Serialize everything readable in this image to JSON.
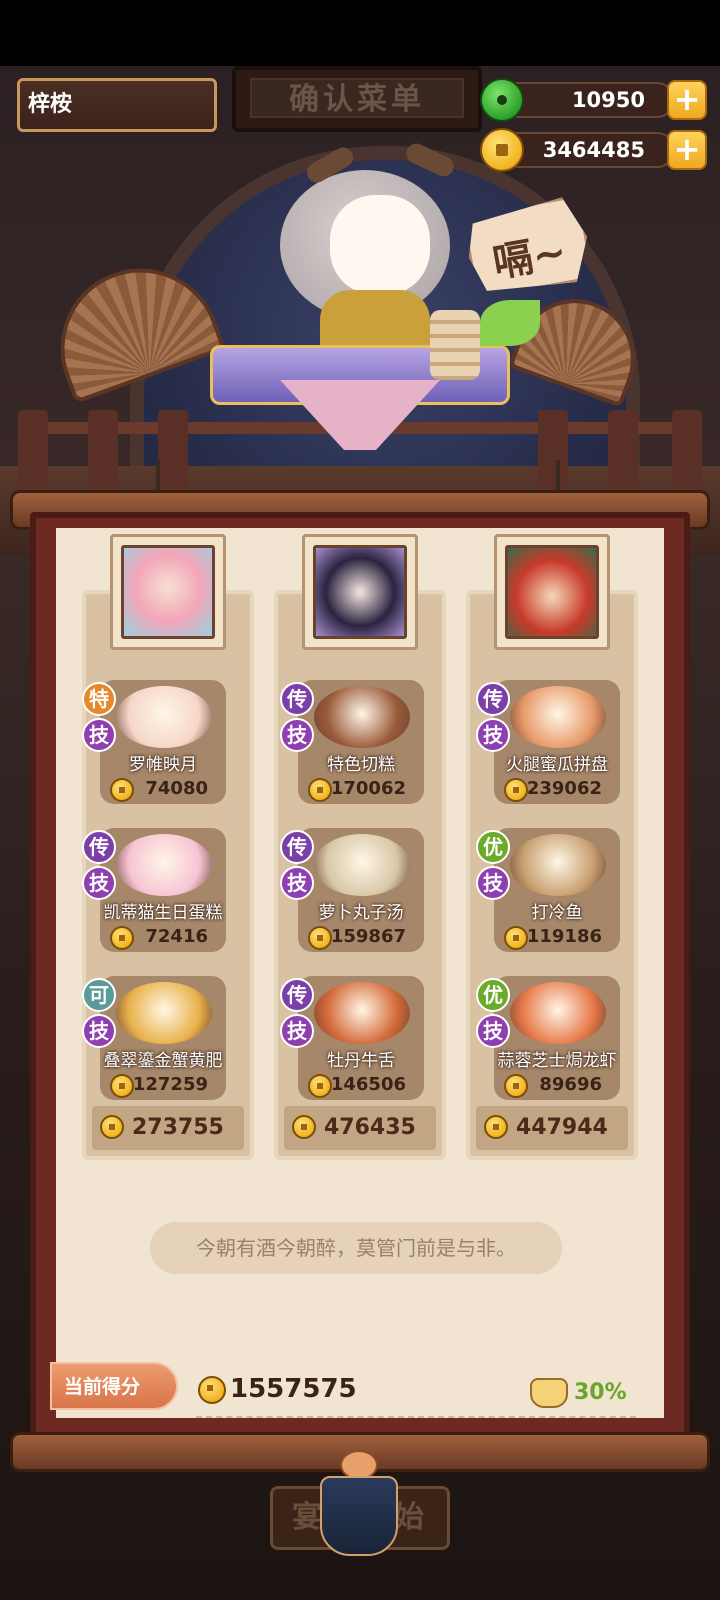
{
  "header": {
    "player_name": "梓桉",
    "sign_title": "确认菜单",
    "jade_amount": "10950",
    "coin_amount": "3464485",
    "plus_label": "+"
  },
  "character": {
    "speech": "嗝~"
  },
  "columns": [
    {
      "total": "273755",
      "dishes": [
        {
          "tag1": "特",
          "tag1_color": "#e7882a",
          "tag2": "技",
          "name": "罗帷映月",
          "price": "74080",
          "food_color": "#f5d6c8"
        },
        {
          "tag1": "传",
          "tag1_color": "#7b3fa8",
          "tag2": "技",
          "name": "凯蒂猫生日蛋糕",
          "price": "72416",
          "food_color": "#f7c4d4"
        },
        {
          "tag1": "可",
          "tag1_color": "#5a9a9a",
          "tag2": "技",
          "name": "叠翠鎏金蟹黄肥",
          "price": "127259",
          "food_color": "#e8b24a"
        }
      ]
    },
    {
      "total": "476435",
      "dishes": [
        {
          "tag1": "传",
          "tag1_color": "#7b3fa8",
          "tag2": "技",
          "name": "特色切糕",
          "price": "170062",
          "food_color": "#9a5a3a"
        },
        {
          "tag1": "传",
          "tag1_color": "#7b3fa8",
          "tag2": "技",
          "name": "萝卜丸子汤",
          "price": "159867",
          "food_color": "#d8c8a8"
        },
        {
          "tag1": "传",
          "tag1_color": "#7b3fa8",
          "tag2": "技",
          "name": "牡丹牛舌",
          "price": "146506",
          "food_color": "#d46a3a"
        }
      ]
    },
    {
      "total": "447944",
      "dishes": [
        {
          "tag1": "传",
          "tag1_color": "#7b3fa8",
          "tag2": "技",
          "name": "火腿蜜瓜拼盘",
          "price": "239062",
          "food_color": "#e89a6a"
        },
        {
          "tag1": "优",
          "tag1_color": "#6aab2a",
          "tag2": "技",
          "name": "打冷鱼",
          "price": "119186",
          "food_color": "#c8a070"
        },
        {
          "tag1": "优",
          "tag1_color": "#6aab2a",
          "tag2": "技",
          "name": "蒜蓉芝士焗龙虾",
          "price": "89696",
          "food_color": "#e87a4a"
        }
      ]
    }
  ],
  "quote": "今朝有酒今朝醉，莫管门前是与非。",
  "score": {
    "label": "当前得分",
    "value": "1557575",
    "bonus": "30%"
  },
  "start_button": "宴会开始"
}
